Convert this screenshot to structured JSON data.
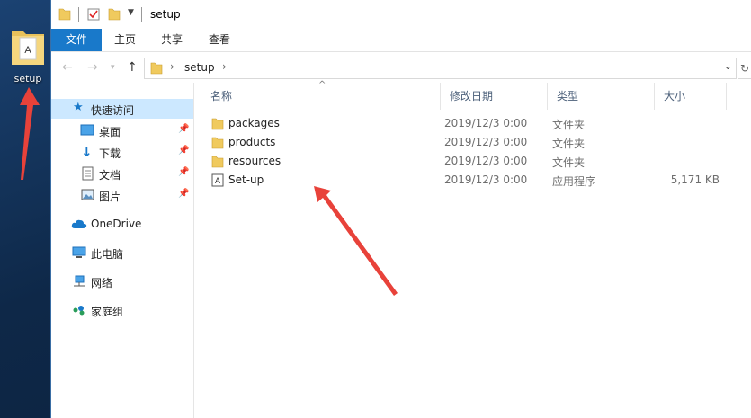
{
  "desktop": {
    "icon_label": "setup"
  },
  "titlebar": {
    "title": "setup"
  },
  "ribbon": {
    "tabs": [
      "文件",
      "主页",
      "共享",
      "查看"
    ]
  },
  "address": {
    "path": "setup"
  },
  "navpane": {
    "quick_access": "快速访问",
    "desktop": "桌面",
    "downloads": "下载",
    "documents": "文档",
    "pictures": "图片",
    "onedrive": "OneDrive",
    "this_pc": "此电脑",
    "network": "网络",
    "homegroup": "家庭组"
  },
  "columns": {
    "name": "名称",
    "date": "修改日期",
    "type": "类型",
    "size": "大小"
  },
  "files": [
    {
      "name": "packages",
      "date": "2019/12/3 0:00",
      "type": "文件夹",
      "size": ""
    },
    {
      "name": "products",
      "date": "2019/12/3 0:00",
      "type": "文件夹",
      "size": ""
    },
    {
      "name": "resources",
      "date": "2019/12/3 0:00",
      "type": "文件夹",
      "size": ""
    },
    {
      "name": "Set-up",
      "date": "2019/12/3 0:00",
      "type": "应用程序",
      "size": "5,171 KB"
    }
  ],
  "colors": {
    "ribbon_active": "#1979ca",
    "selected": "#cce8ff",
    "arrow": "#e8423a"
  }
}
